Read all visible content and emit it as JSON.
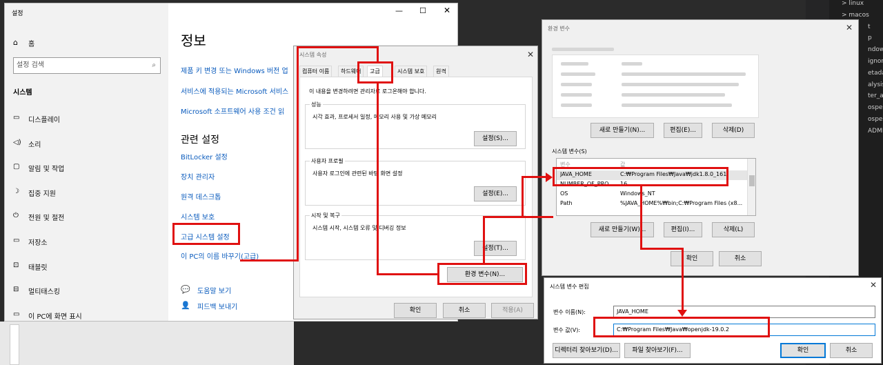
{
  "editor": {
    "tree": [
      "linux",
      "macos",
      "t",
      "p",
      "ndows",
      "ignore",
      "etadata",
      "alysis_op",
      "ter_appl",
      "ospec.loc",
      "ospec.ya",
      "ADME.m"
    ]
  },
  "settings": {
    "title": "설정",
    "home": "홈",
    "search_placeholder": "설정 검색",
    "section": "시스템",
    "nav": [
      "디스플레이",
      "소리",
      "알림 및 작업",
      "집중 지원",
      "전원 및 절전",
      "저장소",
      "태블릿",
      "멀티태스킹",
      "이 PC에 화면 표시"
    ],
    "page_title": "정보",
    "links_top": [
      "제품 키 변경 또는 Windows 버전 업",
      "서비스에 적용되는 Microsoft 서비스",
      "Microsoft 소프트웨어 사용 조건 읽"
    ],
    "related_title": "관련 설정",
    "related": [
      "BitLocker 설정",
      "장치 관리자",
      "원격 데스크톱",
      "시스템 보호",
      "고급 시스템 설정",
      "이 PC의 이름 바꾸기(고급)"
    ],
    "help": "도움말 보기",
    "feedback": "피드백 보내기"
  },
  "sysprops": {
    "title": "시스템 속성",
    "tabs": [
      "컴퓨터 이름",
      "하드웨어",
      "고급",
      "시스템 보호",
      "원격"
    ],
    "admin_note": "이 내용을 변경하려면 관리자로 로그온해야 합니다.",
    "perf": {
      "label": "성능",
      "desc": "시각 효과, 프로세서 일정, 메모리 사용 및 가상 메모리",
      "btn": "설정(S)..."
    },
    "profile": {
      "label": "사용자 프로필",
      "desc": "사용자 로그인에 관련된 바탕 화면 설정",
      "btn": "설정(E)..."
    },
    "startup": {
      "label": "시작 및 복구",
      "desc": "시스템 시작, 시스템 오류 및 디버깅 정보",
      "btn": "설정(T)..."
    },
    "env_btn": "환경 변수(N)...",
    "ok": "확인",
    "cancel": "취소",
    "apply": "적용(A)"
  },
  "envvars": {
    "title": "환경 변수",
    "user_section": "(blurred) 사용자 변수",
    "user_new": "새로 만들기(N)...",
    "user_edit": "편집(E)...",
    "user_delete": "삭제(D)",
    "sys_section": "시스템 변수(S)",
    "col_var": "변수",
    "col_val": "값",
    "rows": [
      {
        "name": "JAVA_HOME",
        "value": "C:₩Program Files₩Java₩jdk1.8.0_161"
      },
      {
        "name": "NUMBER_OF_PRO...",
        "value": "16"
      },
      {
        "name": "OS",
        "value": "Windows_NT"
      },
      {
        "name": "Path",
        "value": "%JAVA_HOME%₩bin;C:₩Program Files (x8..."
      }
    ],
    "sys_new": "새로 만들기(W)...",
    "sys_edit": "편집(I)...",
    "sys_delete": "삭제(L)",
    "ok": "확인",
    "cancel": "취소"
  },
  "editvar": {
    "title": "시스템 변수 편집",
    "name_label": "변수 이름(N):",
    "name_value": "JAVA_HOME",
    "value_label": "변수 값(V):",
    "value_value": "C:₩Program Files₩Java₩openjdk-19.0.2",
    "browse_dir": "디렉터리 찾아보기(D)...",
    "browse_file": "파일 찾아보기(F)...",
    "ok": "확인",
    "cancel": "취소"
  },
  "colors": {
    "highlight": "#e01010",
    "link": "#0a5bbd",
    "dialog": "#f0f0f0"
  }
}
